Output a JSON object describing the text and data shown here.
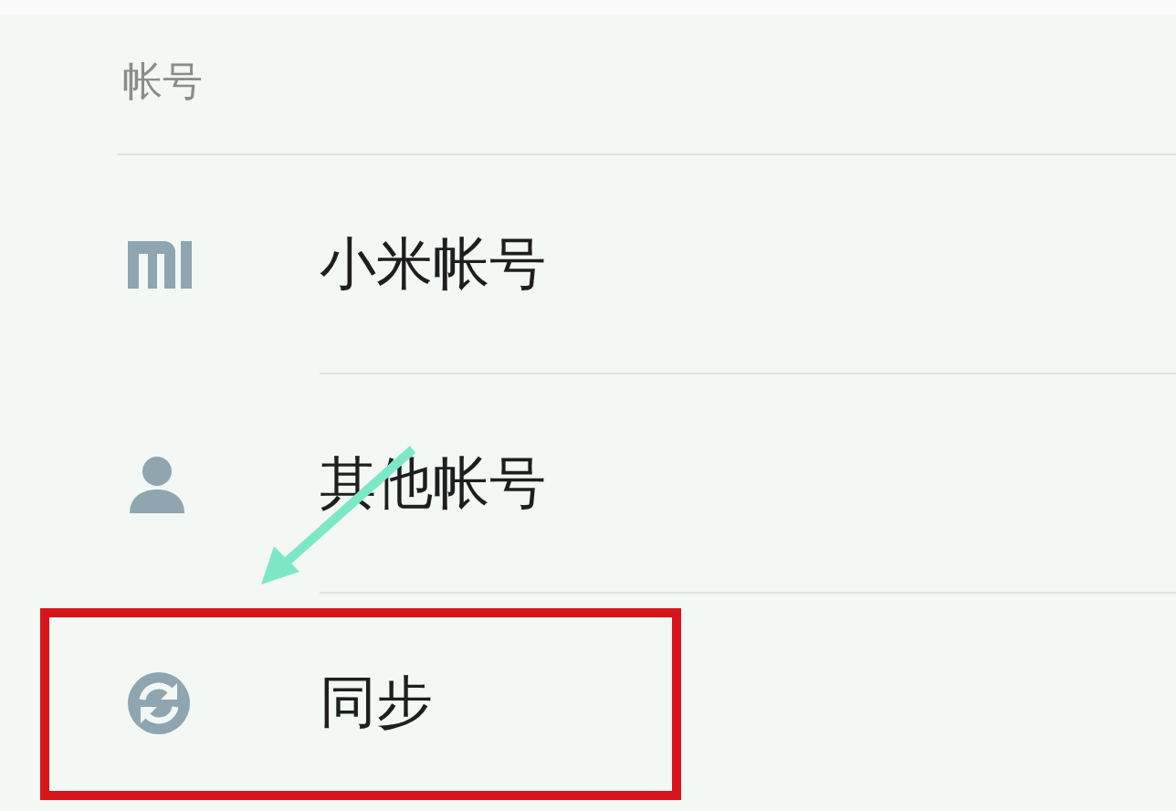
{
  "section": {
    "title": "帐号"
  },
  "items": [
    {
      "kind": "mi",
      "label": "小米帐号",
      "highlighted": false
    },
    {
      "kind": "person",
      "label": "其他帐号",
      "highlighted": false
    },
    {
      "kind": "sync",
      "label": "同步",
      "highlighted": true
    }
  ]
}
